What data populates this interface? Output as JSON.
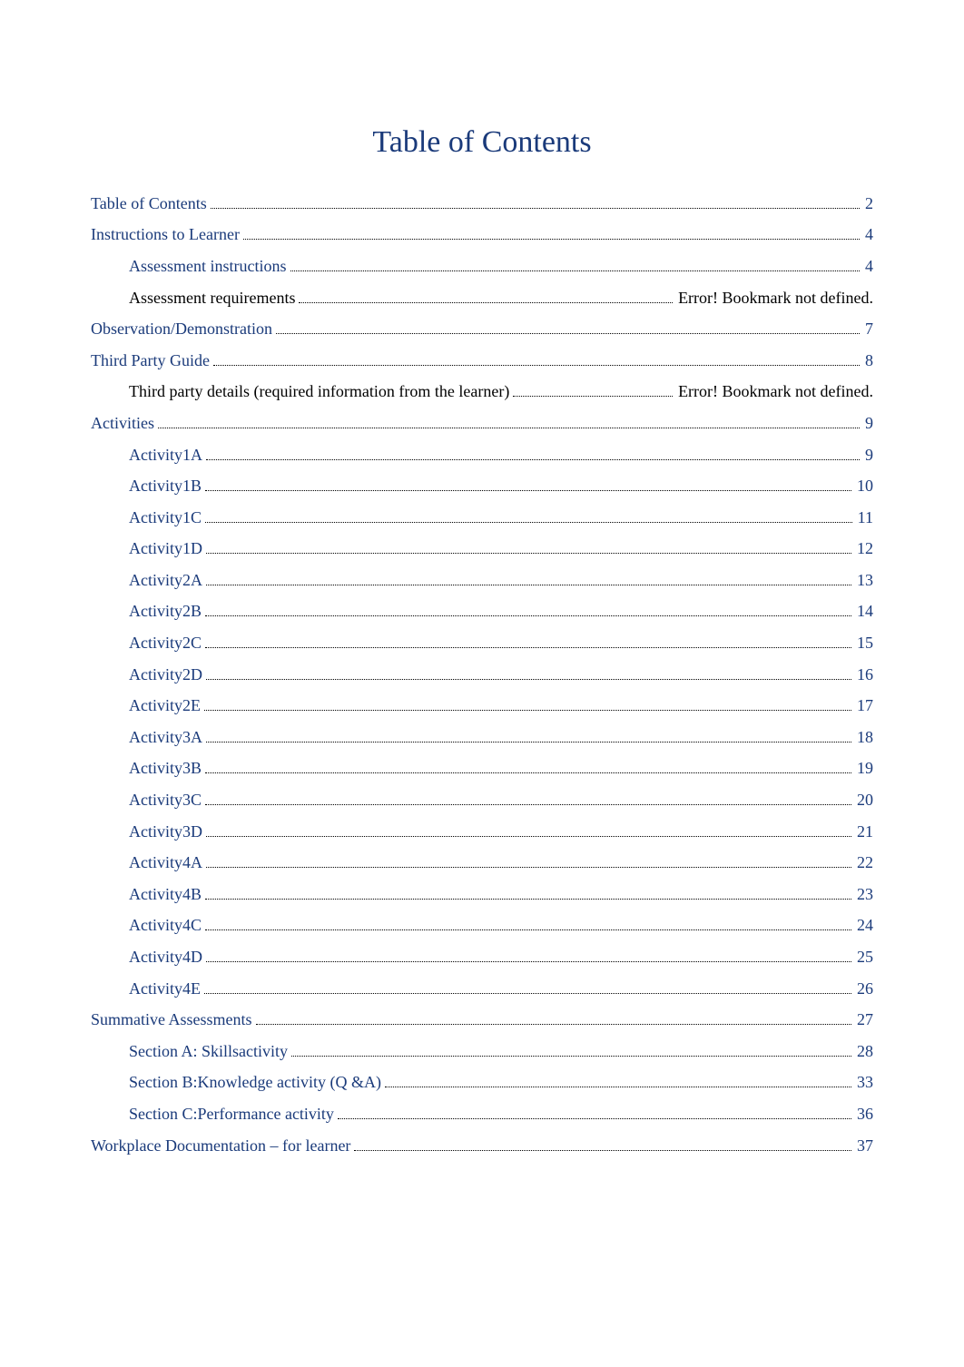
{
  "title": "Table of Contents",
  "toc": [
    {
      "label": "Table of Contents",
      "page": "2",
      "indent": false,
      "link": true
    },
    {
      "label": "Instructions  to Learner",
      "page": "4",
      "indent": false,
      "link": true
    },
    {
      "label": "Assessment instructions",
      "page": "4",
      "indent": true,
      "link": true
    },
    {
      "label": "Assessment requirements",
      "page": "Error! Bookmark not defined.",
      "indent": true,
      "link": false
    },
    {
      "label": "Observation/Demonstration",
      "page": "7",
      "indent": false,
      "link": true
    },
    {
      "label": "Third Party Guide",
      "page": "8",
      "indent": false,
      "link": true
    },
    {
      "label": "Third party details (required information from the learner)",
      "page": "Error! Bookmark not defined.",
      "indent": true,
      "link": false
    },
    {
      "label": "Activities",
      "page": "9",
      "indent": false,
      "link": true
    },
    {
      "label": "Activity1A",
      "page": "9",
      "indent": true,
      "link": true
    },
    {
      "label": "Activity1B",
      "page": "10",
      "indent": true,
      "link": true
    },
    {
      "label": "Activity1C",
      "page": "11",
      "indent": true,
      "link": true
    },
    {
      "label": "Activity1D",
      "page": "12",
      "indent": true,
      "link": true
    },
    {
      "label": "Activity2A",
      "page": "13",
      "indent": true,
      "link": true
    },
    {
      "label": "Activity2B",
      "page": "14",
      "indent": true,
      "link": true
    },
    {
      "label": "Activity2C",
      "page": "15",
      "indent": true,
      "link": true
    },
    {
      "label": "Activity2D",
      "page": "16",
      "indent": true,
      "link": true
    },
    {
      "label": "Activity2E",
      "page": "17",
      "indent": true,
      "link": true
    },
    {
      "label": "Activity3A",
      "page": "18",
      "indent": true,
      "link": true
    },
    {
      "label": "Activity3B",
      "page": "19",
      "indent": true,
      "link": true
    },
    {
      "label": "Activity3C",
      "page": "20",
      "indent": true,
      "link": true
    },
    {
      "label": "Activity3D",
      "page": "21",
      "indent": true,
      "link": true
    },
    {
      "label": "Activity4A",
      "page": "22",
      "indent": true,
      "link": true
    },
    {
      "label": "Activity4B",
      "page": "23",
      "indent": true,
      "link": true
    },
    {
      "label": "Activity4C",
      "page": "24",
      "indent": true,
      "link": true
    },
    {
      "label": "Activity4D",
      "page": "25",
      "indent": true,
      "link": true
    },
    {
      "label": "Activity4E",
      "page": "26",
      "indent": true,
      "link": true
    },
    {
      "label": "Summative Assessments",
      "page": "27",
      "indent": false,
      "link": true
    },
    {
      "label": "Section A: Skillsactivity",
      "page": "28",
      "indent": true,
      "link": true
    },
    {
      "label": "Section B:Knowledge activity (Q &A)",
      "page": "33",
      "indent": true,
      "link": true
    },
    {
      "label": "Section C:Performance activity",
      "page": "36",
      "indent": true,
      "link": true
    },
    {
      "label": "Workplace Documentation  – for learner",
      "page": "37",
      "indent": false,
      "link": true
    }
  ]
}
